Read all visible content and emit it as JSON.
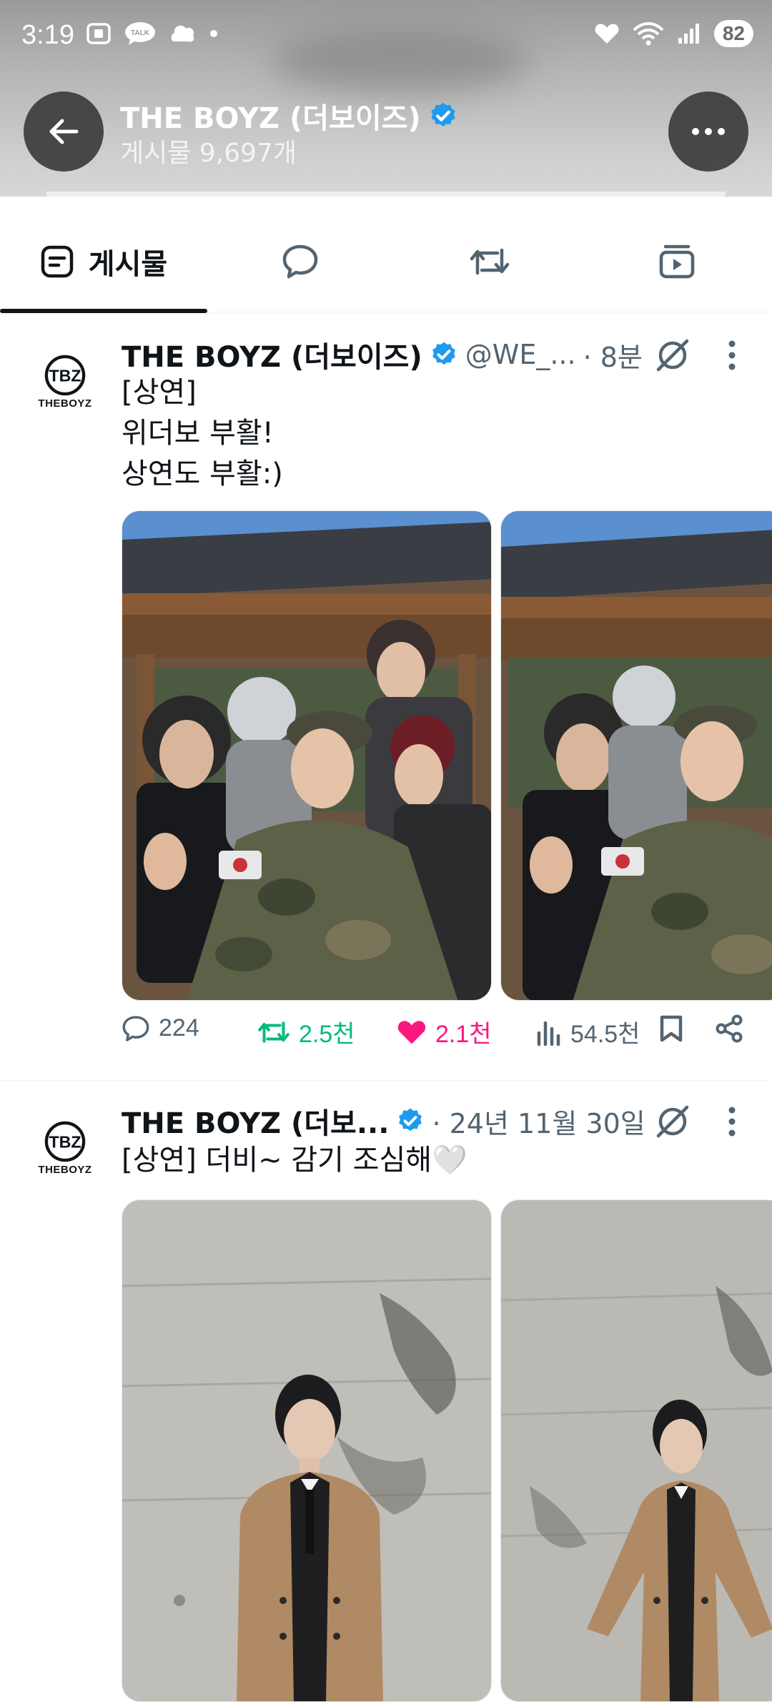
{
  "status_bar": {
    "time": "3:19",
    "battery": "82",
    "left_icons": [
      "screenshot-icon",
      "kakaotalk-icon",
      "threads-icon"
    ],
    "right_icons": [
      "heart-icon",
      "wifi-icon",
      "signal-icon"
    ]
  },
  "header": {
    "name": "THE BOYZ (더보이즈)",
    "verified": true,
    "post_count": "게시물 9,697개",
    "back_icon": "arrow-left-icon",
    "more_icon": "more-horizontal-icon"
  },
  "tabs": [
    {
      "label": "게시물",
      "icon": "posts-icon",
      "active": true
    },
    {
      "label": "",
      "icon": "replies-icon",
      "active": false
    },
    {
      "label": "",
      "icon": "repost-icon",
      "active": false
    },
    {
      "label": "",
      "icon": "media-icon",
      "active": false
    }
  ],
  "posts": [
    {
      "author": "THE BOYZ (더보이즈)",
      "avatar_text": "THEBOYZ",
      "avatar_monogram": "TBZ",
      "handle": "@WE_...",
      "time": "· 8분",
      "text": "[상연]\n위더보 부활!\n상연도 부활:)",
      "actions": {
        "replies": "224",
        "reposts": "2.5천",
        "likes": "2.1천",
        "views": "54.5천"
      },
      "liked": true,
      "reposted": true,
      "photos": 2
    },
    {
      "author": "THE BOYZ (더보...",
      "avatar_text": "THEBOYZ",
      "avatar_monogram": "TBZ",
      "handle": "",
      "time": "· 24년 11월 30일",
      "text": "[상연] 더비~ 감기 조심해🤍",
      "photos": 2
    }
  ],
  "colors": {
    "verified": "#1d9bf0",
    "like": "#f91880",
    "repost": "#00ba7c",
    "muted": "#536471",
    "text": "#0f1419"
  }
}
